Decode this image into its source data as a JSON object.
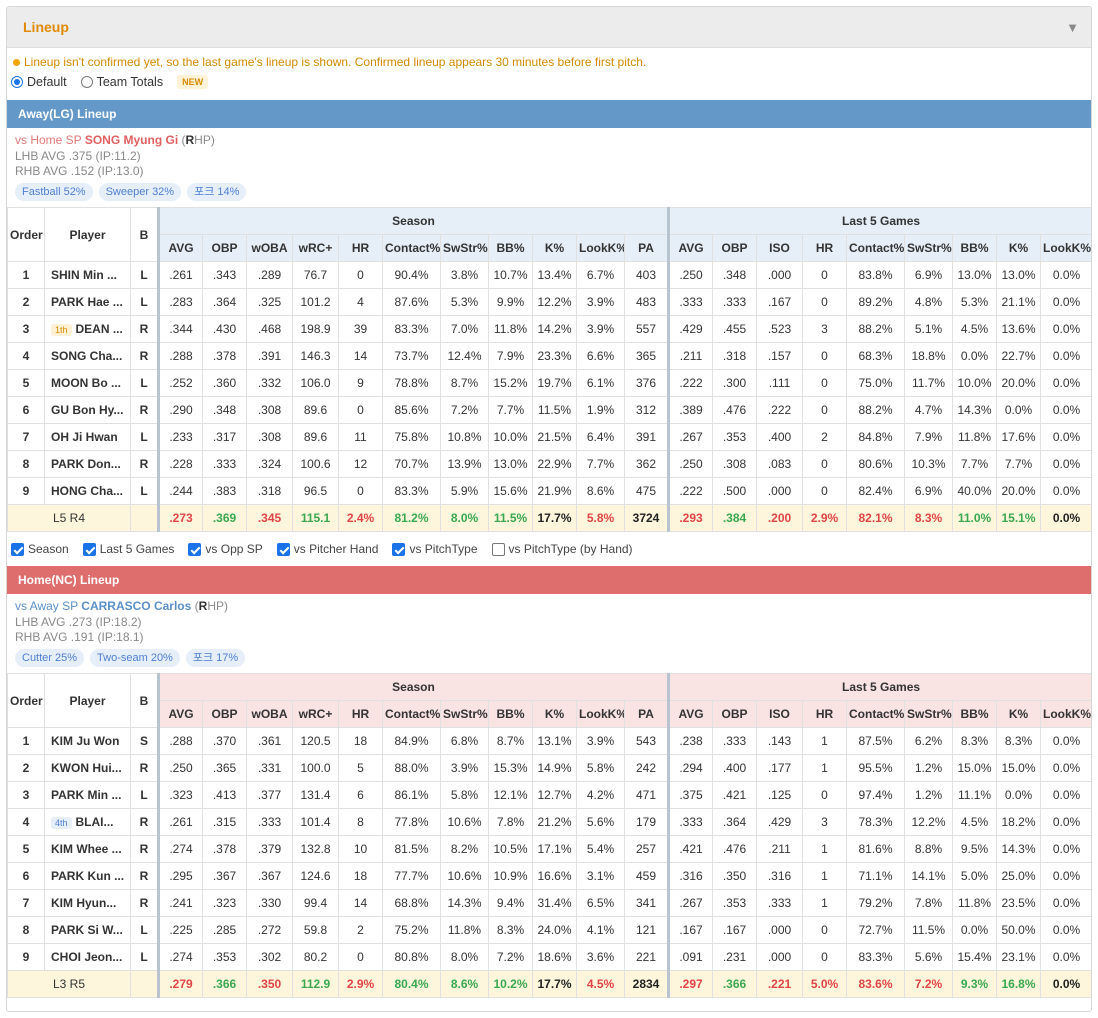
{
  "panel": {
    "title": "Lineup",
    "collapse_icon": "caret-down-icon"
  },
  "notice": "Lineup isn't confirmed yet, so the last game's lineup is shown. Confirmed lineup appears 30 minutes before first pitch.",
  "mode": {
    "default_label": "Default",
    "team_totals_label": "Team Totals",
    "new_badge": "NEW",
    "selected": "Default"
  },
  "columns": {
    "order": "Order",
    "player": "Player",
    "bats": "B",
    "season_group": "Season",
    "last5_group": "Last 5 Games",
    "season": [
      "AVG",
      "OBP",
      "wOBA",
      "wRC+",
      "HR",
      "Contact%",
      "SwStr%",
      "BB%",
      "K%",
      "LookK%",
      "PA"
    ],
    "last5": [
      "AVG",
      "OBP",
      "ISO",
      "HR",
      "Contact%",
      "SwStr%",
      "BB%",
      "K%",
      "LookK%"
    ]
  },
  "away": {
    "header": "Away(LG) Lineup",
    "sp_prefix": "vs Home SP",
    "sp_name": "SONG Myung Gi",
    "sp_hand_open": "(",
    "sp_hand_letter": "R",
    "sp_hand_close": "HP)",
    "lhb": "LHB AVG .375 (IP:11.2)",
    "rhb": "RHB AVG .152 (IP:13.0)",
    "pitches": [
      "Fastball 52%",
      "Sweeper 32%",
      "포크 14%"
    ],
    "rows": [
      {
        "order": "1",
        "player": "SHIN Min ...",
        "mark": "",
        "bats": "L",
        "season": [
          ".261",
          ".343",
          ".289",
          "76.7",
          "0",
          "90.4%",
          "3.8%",
          "10.7%",
          "13.4%",
          "6.7%",
          "403"
        ],
        "last5": [
          ".250",
          ".348",
          ".000",
          "0",
          "83.8%",
          "6.9%",
          "13.0%",
          "13.0%",
          "0.0%"
        ]
      },
      {
        "order": "2",
        "player": "PARK Hae ...",
        "mark": "",
        "bats": "L",
        "season": [
          ".283",
          ".364",
          ".325",
          "101.2",
          "4",
          "87.6%",
          "5.3%",
          "9.9%",
          "12.2%",
          "3.9%",
          "483"
        ],
        "last5": [
          ".333",
          ".333",
          ".167",
          "0",
          "89.2%",
          "4.8%",
          "5.3%",
          "21.1%",
          "0.0%"
        ]
      },
      {
        "order": "3",
        "player": "DEAN ...",
        "mark": "1th",
        "bats": "R",
        "season": [
          ".344",
          ".430",
          ".468",
          "198.9",
          "39",
          "83.3%",
          "7.0%",
          "11.8%",
          "14.2%",
          "3.9%",
          "557"
        ],
        "last5": [
          ".429",
          ".455",
          ".523",
          "3",
          "88.2%",
          "5.1%",
          "4.5%",
          "13.6%",
          "0.0%"
        ]
      },
      {
        "order": "4",
        "player": "SONG Cha...",
        "mark": "",
        "bats": "R",
        "season": [
          ".288",
          ".378",
          ".391",
          "146.3",
          "14",
          "73.7%",
          "12.4%",
          "7.9%",
          "23.3%",
          "6.6%",
          "365"
        ],
        "last5": [
          ".211",
          ".318",
          ".157",
          "0",
          "68.3%",
          "18.8%",
          "0.0%",
          "22.7%",
          "0.0%"
        ]
      },
      {
        "order": "5",
        "player": "MOON Bo ...",
        "mark": "",
        "bats": "L",
        "season": [
          ".252",
          ".360",
          ".332",
          "106.0",
          "9",
          "78.8%",
          "8.7%",
          "15.2%",
          "19.7%",
          "6.1%",
          "376"
        ],
        "last5": [
          ".222",
          ".300",
          ".111",
          "0",
          "75.0%",
          "11.7%",
          "10.0%",
          "20.0%",
          "0.0%"
        ]
      },
      {
        "order": "6",
        "player": "GU Bon Hy...",
        "mark": "",
        "bats": "R",
        "season": [
          ".290",
          ".348",
          ".308",
          "89.6",
          "0",
          "85.6%",
          "7.2%",
          "7.7%",
          "11.5%",
          "1.9%",
          "312"
        ],
        "last5": [
          ".389",
          ".476",
          ".222",
          "0",
          "88.2%",
          "4.7%",
          "14.3%",
          "0.0%",
          "0.0%"
        ]
      },
      {
        "order": "7",
        "player": "OH Ji Hwan",
        "mark": "",
        "bats": "L",
        "season": [
          ".233",
          ".317",
          ".308",
          "89.6",
          "11",
          "75.8%",
          "10.8%",
          "10.0%",
          "21.5%",
          "6.4%",
          "391"
        ],
        "last5": [
          ".267",
          ".353",
          ".400",
          "2",
          "84.8%",
          "7.9%",
          "11.8%",
          "17.6%",
          "0.0%"
        ]
      },
      {
        "order": "8",
        "player": "PARK Don...",
        "mark": "",
        "bats": "R",
        "season": [
          ".228",
          ".333",
          ".324",
          "100.6",
          "12",
          "70.7%",
          "13.9%",
          "13.0%",
          "22.9%",
          "7.7%",
          "362"
        ],
        "last5": [
          ".250",
          ".308",
          ".083",
          "0",
          "80.6%",
          "10.3%",
          "7.7%",
          "7.7%",
          "0.0%"
        ]
      },
      {
        "order": "9",
        "player": "HONG Cha...",
        "mark": "",
        "bats": "L",
        "season": [
          ".244",
          ".383",
          ".318",
          "96.5",
          "0",
          "83.3%",
          "5.9%",
          "15.6%",
          "21.9%",
          "8.6%",
          "475"
        ],
        "last5": [
          ".222",
          ".500",
          ".000",
          "0",
          "82.4%",
          "6.9%",
          "40.0%",
          "20.0%",
          "0.0%"
        ]
      }
    ],
    "total_label_prefix": "L5 R4",
    "total_season": [
      ".273",
      ".369",
      ".345",
      "115.1",
      "2.4%",
      "81.2%",
      "8.0%",
      "11.5%",
      "17.7%",
      "5.8%",
      "3724"
    ],
    "total_last5": [
      ".293",
      ".384",
      ".200",
      "2.9%",
      "82.1%",
      "8.3%",
      "11.0%",
      "15.1%",
      "0.0%"
    ]
  },
  "options": [
    "Season",
    "Last 5 Games",
    "vs Opp SP",
    "vs Pitcher Hand",
    "vs PitchType",
    "vs PitchType (by Hand)"
  ],
  "options_checked": [
    true,
    true,
    true,
    true,
    true,
    false
  ],
  "home": {
    "header": "Home(NC) Lineup",
    "sp_prefix": "vs Away SP",
    "sp_name": "CARRASCO Carlos",
    "sp_hand_open": "(",
    "sp_hand_letter": "R",
    "sp_hand_close": "HP)",
    "lhb": "LHB AVG .273 (IP:18.2)",
    "rhb": "RHB AVG .191 (IP:18.1)",
    "pitches": [
      "Cutter 25%",
      "Two-seam 20%",
      "포크 17%"
    ],
    "rows": [
      {
        "order": "1",
        "player": "KIM Ju Won",
        "mark": "",
        "bats": "S",
        "season": [
          ".288",
          ".370",
          ".361",
          "120.5",
          "18",
          "84.9%",
          "6.8%",
          "8.7%",
          "13.1%",
          "3.9%",
          "543"
        ],
        "last5": [
          ".238",
          ".333",
          ".143",
          "1",
          "87.5%",
          "6.2%",
          "8.3%",
          "8.3%",
          "0.0%"
        ]
      },
      {
        "order": "2",
        "player": "KWON Hui...",
        "mark": "",
        "bats": "R",
        "season": [
          ".250",
          ".365",
          ".331",
          "100.0",
          "5",
          "88.0%",
          "3.9%",
          "15.3%",
          "14.9%",
          "5.8%",
          "242"
        ],
        "last5": [
          ".294",
          ".400",
          ".177",
          "1",
          "95.5%",
          "1.2%",
          "15.0%",
          "15.0%",
          "0.0%"
        ]
      },
      {
        "order": "3",
        "player": "PARK Min ...",
        "mark": "",
        "bats": "L",
        "season": [
          ".323",
          ".413",
          ".377",
          "131.4",
          "6",
          "86.1%",
          "5.8%",
          "12.1%",
          "12.7%",
          "4.2%",
          "471"
        ],
        "last5": [
          ".375",
          ".421",
          ".125",
          "0",
          "97.4%",
          "1.2%",
          "11.1%",
          "0.0%",
          "0.0%"
        ]
      },
      {
        "order": "4",
        "player": "BLAI...",
        "mark": "4th",
        "bats": "R",
        "season": [
          ".261",
          ".315",
          ".333",
          "101.4",
          "8",
          "77.8%",
          "10.6%",
          "7.8%",
          "21.2%",
          "5.6%",
          "179"
        ],
        "last5": [
          ".333",
          ".364",
          ".429",
          "3",
          "78.3%",
          "12.2%",
          "4.5%",
          "18.2%",
          "0.0%"
        ]
      },
      {
        "order": "5",
        "player": "KIM Whee ...",
        "mark": "",
        "bats": "R",
        "season": [
          ".274",
          ".378",
          ".379",
          "132.8",
          "10",
          "81.5%",
          "8.2%",
          "10.5%",
          "17.1%",
          "5.4%",
          "257"
        ],
        "last5": [
          ".421",
          ".476",
          ".211",
          "1",
          "81.6%",
          "8.8%",
          "9.5%",
          "14.3%",
          "0.0%"
        ]
      },
      {
        "order": "6",
        "player": "PARK Kun ...",
        "mark": "",
        "bats": "R",
        "season": [
          ".295",
          ".367",
          ".367",
          "124.6",
          "18",
          "77.7%",
          "10.6%",
          "10.9%",
          "16.6%",
          "3.1%",
          "459"
        ],
        "last5": [
          ".316",
          ".350",
          ".316",
          "1",
          "71.1%",
          "14.1%",
          "5.0%",
          "25.0%",
          "0.0%"
        ]
      },
      {
        "order": "7",
        "player": "KIM Hyun...",
        "mark": "",
        "bats": "R",
        "season": [
          ".241",
          ".323",
          ".330",
          "99.4",
          "14",
          "68.8%",
          "14.3%",
          "9.4%",
          "31.4%",
          "6.5%",
          "341"
        ],
        "last5": [
          ".267",
          ".353",
          ".333",
          "1",
          "79.2%",
          "7.8%",
          "11.8%",
          "23.5%",
          "0.0%"
        ]
      },
      {
        "order": "8",
        "player": "PARK Si W...",
        "mark": "",
        "bats": "L",
        "season": [
          ".225",
          ".285",
          ".272",
          "59.8",
          "2",
          "75.2%",
          "11.8%",
          "8.3%",
          "24.0%",
          "4.1%",
          "121"
        ],
        "last5": [
          ".167",
          ".167",
          ".000",
          "0",
          "72.7%",
          "11.5%",
          "0.0%",
          "50.0%",
          "0.0%"
        ]
      },
      {
        "order": "9",
        "player": "CHOI Jeon...",
        "mark": "",
        "bats": "L",
        "season": [
          ".274",
          ".353",
          ".302",
          "80.2",
          "0",
          "80.8%",
          "8.0%",
          "7.2%",
          "18.6%",
          "3.6%",
          "221"
        ],
        "last5": [
          ".091",
          ".231",
          ".000",
          "0",
          "83.3%",
          "5.6%",
          "15.4%",
          "23.1%",
          "0.0%"
        ]
      }
    ],
    "total_label_prefix": "L3 R5",
    "total_season": [
      ".279",
      ".366",
      ".350",
      "112.9",
      "2.9%",
      "80.4%",
      "8.6%",
      "10.2%",
      "17.7%",
      "4.5%",
      "2834"
    ],
    "total_last5": [
      ".297",
      ".366",
      ".221",
      "5.0%",
      "83.6%",
      "7.2%",
      "9.3%",
      "16.8%",
      "0.0%"
    ]
  },
  "colors": {
    "good": "#3aa850",
    "bad": "#e04444",
    "away_bar": "#6398c8",
    "home_bar": "#de6e6e",
    "accent": "#e08a00"
  }
}
